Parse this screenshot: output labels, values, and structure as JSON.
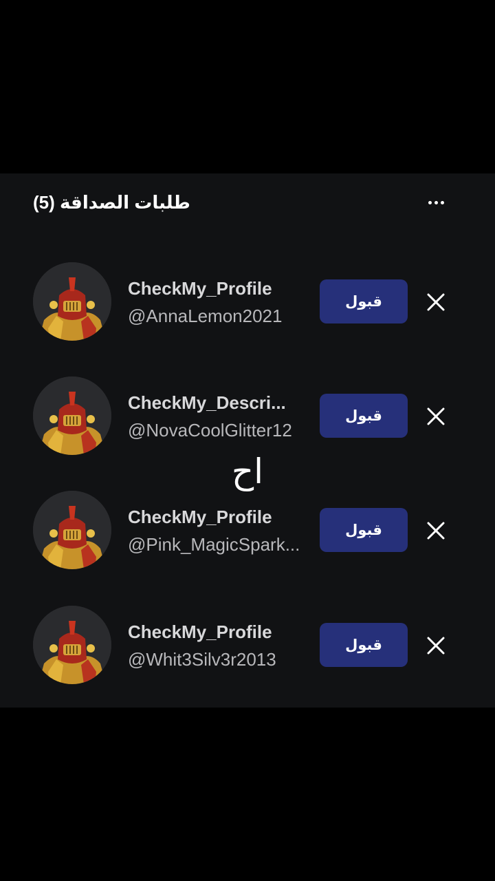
{
  "header": {
    "title": "طلبات الصداقة (5)",
    "more_icon": "more-horizontal-icon"
  },
  "requests": [
    {
      "display_name": "CheckMy_Profile",
      "username": "@AnnaLemon2021",
      "accept_label": "قبول",
      "decline_icon": "close-icon",
      "avatar_icon": "knight-avatar"
    },
    {
      "display_name": "CheckMy_Descri...",
      "username": "@NovaCoolGlitter12",
      "accept_label": "قبول",
      "decline_icon": "close-icon",
      "avatar_icon": "knight-avatar"
    },
    {
      "display_name": "CheckMy_Profile",
      "username": "@Pink_MagicSpark...",
      "accept_label": "قبول",
      "decline_icon": "close-icon",
      "avatar_icon": "knight-avatar"
    },
    {
      "display_name": "CheckMy_Profile",
      "username": "@Whit3Silv3r2013",
      "accept_label": "قبول",
      "decline_icon": "close-icon",
      "avatar_icon": "knight-avatar"
    }
  ],
  "overlay_caption": "اح",
  "colors": {
    "background": "#000000",
    "panel": "#111214",
    "accept_button": "#26307a",
    "text_primary": "#ffffff"
  }
}
